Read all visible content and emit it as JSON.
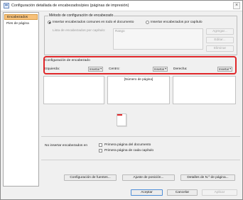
{
  "window": {
    "title": "Configuración detallada de encabezados/pies (páginas de impresión)",
    "close_glyph": "×"
  },
  "sidebar": {
    "items": [
      {
        "label": "Encabezados",
        "active": true
      },
      {
        "label": "Pies de página",
        "active": false
      }
    ]
  },
  "method_group": {
    "title": "Método de configuración de encabezado",
    "option_common": "Insertar encabezados comunes en todo el documento",
    "option_chapter": "Insertar encabezados por capítulo",
    "chapter_list_label": "Lista de encabezados por capítulo:",
    "range_placeholder": "Rango",
    "add_button": "Agregar...",
    "edit_button": "Editar...",
    "delete_button": "Eliminar"
  },
  "header_config": {
    "title": "Configuración de encabezado",
    "left_label": "Izquierda:",
    "center_label": "Centro:",
    "right_label": "Derecha:",
    "insert_label": "Insertar",
    "arrow_glyph": "▾",
    "center_content": "[Número de página]"
  },
  "no_insert": {
    "label": "No insertar encabezados en",
    "first_page_doc": "Primera página del documento",
    "first_page_chapter": "Primera página de cada capítulo"
  },
  "buttons": {
    "font_settings": "Configuración de fuentes...",
    "position_settings": "Ajuste de posición...",
    "number_details": "Detalles de N.º de página...",
    "accept": "Aceptar",
    "cancel": "Cancelar",
    "apply": "Aplicar"
  },
  "colors": {
    "highlight_border": "#e0272a",
    "active_tab": "#f7c17a",
    "primary_button_border": "#4e8ed8"
  }
}
